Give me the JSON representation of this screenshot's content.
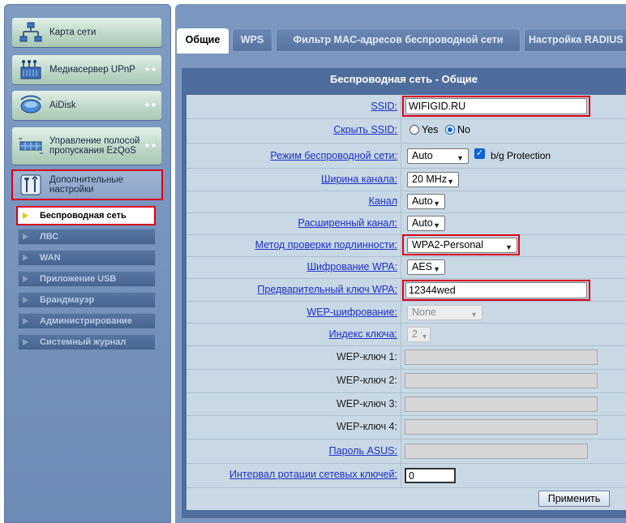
{
  "sidebar": {
    "items": [
      {
        "label": "Карта сети",
        "icon": "network-map-icon"
      },
      {
        "label": "Медиасервер UPnP",
        "icon": "media-server-icon"
      },
      {
        "label": "AiDisk",
        "icon": "aidisk-icon"
      },
      {
        "label": "Управление полосой пропускания EzQoS",
        "icon": "ezqos-icon"
      },
      {
        "label": "Дополнительные настройки",
        "icon": "tools-icon"
      }
    ],
    "submenu": [
      "Беспроводная сеть",
      "ЛВС",
      "WAN",
      "Приложение USB",
      "Брандмауэр",
      "Администрирование",
      "Системный журнал"
    ]
  },
  "tabs": [
    "Общие",
    "WPS",
    "Фильтр MAC-адресов беспроводной сети",
    "Настройка RADIUS"
  ],
  "panel": {
    "title": "Беспроводная сеть - Общие",
    "apply_label": "Применить"
  },
  "form": {
    "ssid": {
      "label": "SSID:",
      "value": "WIFIGID.RU"
    },
    "hide_ssid": {
      "label": "Скрыть SSID:",
      "options": [
        "Yes",
        "No"
      ],
      "selected": "No"
    },
    "mode": {
      "label": "Режим беспроводной сети:",
      "value": "Auto",
      "bg_protection_label": "b/g Protection",
      "bg_protection_checked": true
    },
    "bandwidth": {
      "label": "Ширина канала:",
      "value": "20 MHz"
    },
    "channel": {
      "label": "Канал",
      "value": "Auto"
    },
    "ext_channel": {
      "label": "Расширенный канал:",
      "value": "Auto"
    },
    "auth_method": {
      "label": "Метод проверки подлинности:",
      "value": "WPA2-Personal"
    },
    "wpa_encryption": {
      "label": "Шифрование WPA:",
      "value": "AES"
    },
    "wpa_key": {
      "label": "Предварительный ключ WPA:",
      "value": "12344wed"
    },
    "wep_encryption": {
      "label": "WEP-шифрование:",
      "value": "None"
    },
    "key_index": {
      "label": "Индекс ключа:",
      "value": "2"
    },
    "wep_key1": {
      "label": "WEP-ключ 1:",
      "value": ""
    },
    "wep_key2": {
      "label": "WEP-ключ 2:",
      "value": ""
    },
    "wep_key3": {
      "label": "WEP-ключ 3:",
      "value": ""
    },
    "wep_key4": {
      "label": "WEP-ключ 4:",
      "value": ""
    },
    "asus_pass": {
      "label": "Пароль ASUS:",
      "value": ""
    },
    "rekey": {
      "label": "Интервал ротации сетевых ключей:",
      "value": "0"
    }
  },
  "colors": {
    "highlight": "#d9001b",
    "link_label": "#1f2fc9",
    "panel": "#4e6d9c",
    "form_bg": "#c8d8e4"
  }
}
